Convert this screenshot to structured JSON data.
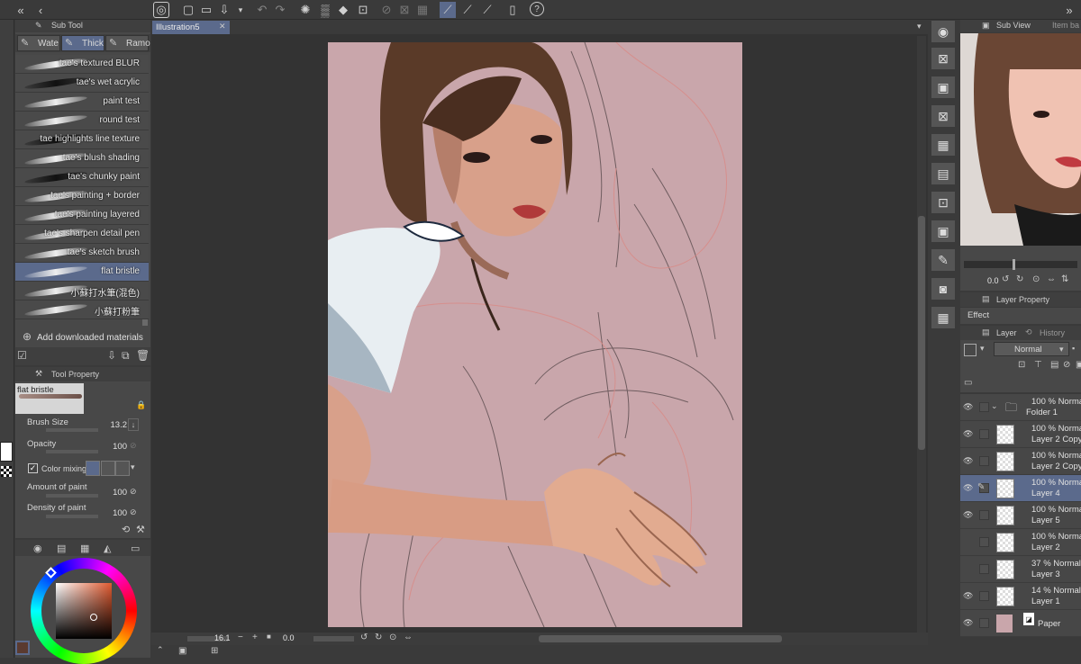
{
  "subtool": {
    "panel_title": "Sub Tool",
    "tabs": [
      "Wate",
      "Thick",
      "Ramo"
    ],
    "brushes": [
      {
        "label": "tae's textured BLUR",
        "dark": false
      },
      {
        "label": "tae's wet acrylic",
        "dark": true
      },
      {
        "label": "paint test",
        "dark": false
      },
      {
        "label": "round test",
        "dark": false
      },
      {
        "label": "tae highlights line texture",
        "dark": true
      },
      {
        "label": "tae's blush shading",
        "dark": false
      },
      {
        "label": "tae's chunky paint",
        "dark": true
      },
      {
        "label": "tae's painting + border",
        "dark": false
      },
      {
        "label": "tae's painting layered",
        "dark": false
      },
      {
        "label": "tae's sharpen detail pen",
        "dark": false
      },
      {
        "label": "tae's sketch brush",
        "dark": false
      },
      {
        "label": "flat bristle",
        "dark": false
      },
      {
        "label": "小蘇打水筆(混色)",
        "dark": false
      },
      {
        "label": "小蘇打粉筆",
        "dark": false
      }
    ],
    "selected_index": 11,
    "add_materials": "Add downloaded materials"
  },
  "tool_property": {
    "title": "Tool Property",
    "brush_name": "flat bristle",
    "brush_size_label": "Brush Size",
    "brush_size_value": "13.2",
    "opacity_label": "Opacity",
    "opacity_value": "100",
    "color_mixing_label": "Color mixing",
    "amount_label": "Amount of paint",
    "amount_value": "100",
    "density_label": "Density of paint",
    "density_value": "100"
  },
  "canvas": {
    "tab_label": "Illustration5",
    "zoom_value": "16.1",
    "rotate_value": "0.0",
    "background_color": "#c9a6ab"
  },
  "subview": {
    "tab1": "Sub View",
    "tab2": "Item ba",
    "zoom_value": "0.0"
  },
  "layer_property": {
    "title": "Layer Property",
    "effect_label": "Effect"
  },
  "layers_panel": {
    "tab_layer": "Layer",
    "tab_history": "History",
    "blend_mode": "Normal",
    "layers": [
      {
        "line1": "100 % Normal",
        "line2": "Folder 1",
        "type": "folder",
        "visible": true
      },
      {
        "line1": "100 % Norma",
        "line2": "Layer 2 Copy",
        "type": "layer",
        "visible": true
      },
      {
        "line1": "100 % Norma",
        "line2": "Layer 2 Copy",
        "type": "layer",
        "visible": true
      },
      {
        "line1": "100 % Norma",
        "line2": "Layer 4",
        "type": "layer",
        "visible": true,
        "selected": true
      },
      {
        "line1": "100 % Norma",
        "line2": "Layer 5",
        "type": "layer",
        "visible": true
      },
      {
        "line1": "100 % Normal",
        "line2": "Layer 2",
        "type": "layer",
        "visible": false
      },
      {
        "line1": "37 % Normal",
        "line2": "Layer 3",
        "type": "layer",
        "visible": false
      },
      {
        "line1": "14 % Normal",
        "line2": "Layer 1",
        "type": "layer",
        "visible": true
      },
      {
        "line1": "",
        "line2": "Paper",
        "type": "paper",
        "visible": true
      }
    ]
  },
  "colors": {
    "selection": "#5b6a8c",
    "canvas_pink": "#c9a6ab",
    "main_color": "#5a3a30",
    "sub_color": "#ffffff"
  }
}
